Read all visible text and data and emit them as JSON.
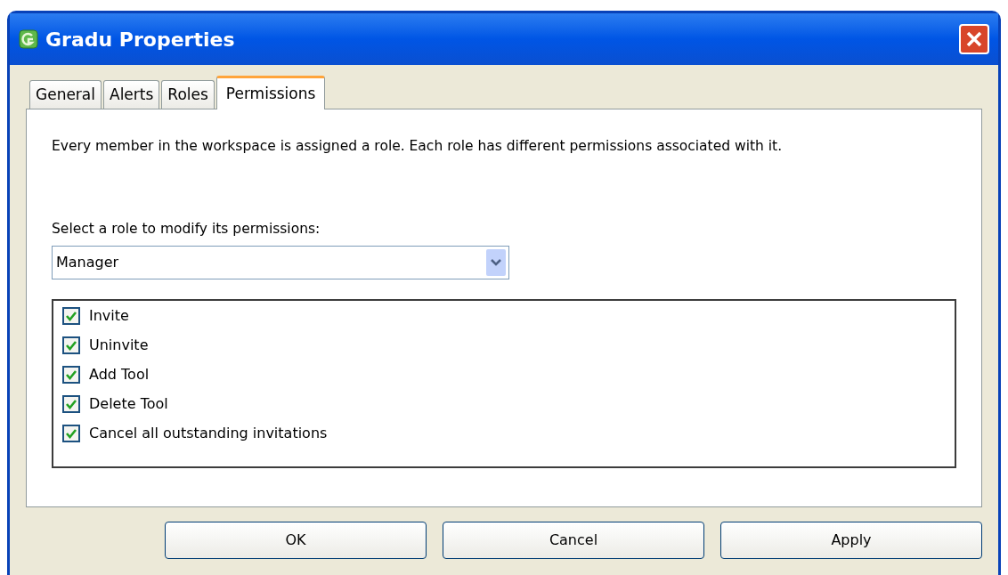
{
  "window": {
    "title": "Gradu Properties"
  },
  "tabs": [
    {
      "label": "General",
      "selected": false
    },
    {
      "label": "Alerts",
      "selected": false
    },
    {
      "label": "Roles",
      "selected": false
    },
    {
      "label": "Permissions",
      "selected": true
    }
  ],
  "description": "Every member in the workspace is assigned a role.  Each role has different permissions associated with it.",
  "role_select": {
    "label": "Select a role to modify its permissions:",
    "value": "Manager"
  },
  "permissions": [
    {
      "label": "Invite",
      "checked": true
    },
    {
      "label": "Uninvite",
      "checked": true
    },
    {
      "label": "Add Tool",
      "checked": true
    },
    {
      "label": "Delete Tool",
      "checked": true
    },
    {
      "label": "Cancel all outstanding invitations",
      "checked": true
    }
  ],
  "buttons": [
    "OK",
    "Cancel",
    "Apply"
  ]
}
